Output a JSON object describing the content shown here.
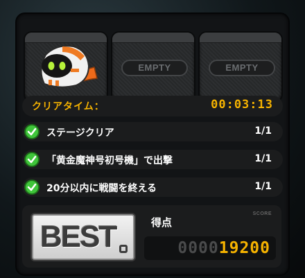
{
  "slots": [
    {
      "status": "filled",
      "character_icon": "robot-character-icon"
    },
    {
      "status": "empty",
      "label": "EMPTY"
    },
    {
      "status": "empty",
      "label": "EMPTY"
    }
  ],
  "clear_time": {
    "label": "クリアタイム：",
    "value": "00:03:13"
  },
  "missions": [
    {
      "text": "ステージクリア",
      "count": "1/1",
      "completed": true
    },
    {
      "text": "「黄金魔神号初号機」で出撃",
      "count": "1/1",
      "completed": true
    },
    {
      "text": "20分以内に戦闘を終える",
      "count": "1/1",
      "completed": true
    }
  ],
  "score": {
    "badge": "BEST",
    "label": "得点",
    "tag": "SCORE",
    "zeros": "0000",
    "value": "19200"
  },
  "colors": {
    "accent": "#f6b300",
    "check": "#3fc53a",
    "panel": "#1b1c1d"
  }
}
